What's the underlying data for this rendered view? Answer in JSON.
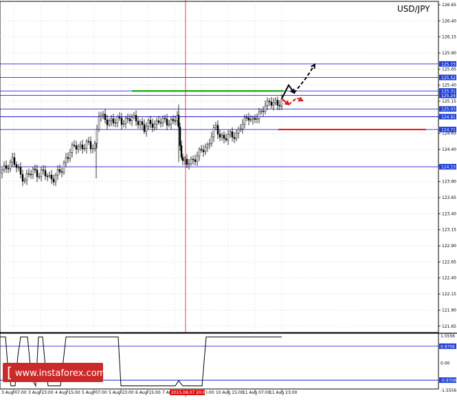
{
  "chart_data": [
    {
      "type": "candlestick",
      "title": "USD/JPY",
      "ylim": [
        121.55,
        126.75
      ],
      "ytick_labels": [
        "126.65",
        "126.40",
        "126.15",
        "125.90",
        "125.65",
        "125.40",
        "125.15",
        "124.90",
        "124.65",
        "124.40",
        "124.15",
        "123.90",
        "123.65",
        "123.40",
        "123.15",
        "122.90",
        "122.65",
        "122.40",
        "122.15",
        "121.90",
        "121.65"
      ],
      "xtick_labels": [
        "3 Aug 07:00",
        "3 Aug 23:00",
        "4 Aug 15:00",
        "5 Aug 07:00",
        "5 Aug 23:00",
        "6 Aug 15:00",
        "7 Aug 07:00",
        "7 Aug 23:00",
        "10 Aug 15:00",
        "11 Aug 07:00",
        "11 Aug 23:00"
      ],
      "crosshair_time_label": "2015.08.07 20:00",
      "levels": [
        {
          "value": 125.73,
          "label": "125.73",
          "color": "#0000cc"
        },
        {
          "value": 125.52,
          "label": "125.52",
          "color": "#0000cc"
        },
        {
          "value": 125.31,
          "label": "125.31",
          "color": "#0000cc"
        },
        {
          "value": 125.24,
          "label": "125.24",
          "color": "#0000cc"
        },
        {
          "value": 125.03,
          "label": "125.03",
          "color": "#0000cc"
        },
        {
          "value": 124.91,
          "label": "124.91",
          "color": "#0000cc"
        },
        {
          "value": 124.71,
          "label": "124.71",
          "color": "#0000cc"
        },
        {
          "value": 124.13,
          "label": "124.13",
          "color": "#0000cc"
        }
      ],
      "level_label_bg": "#1f3fd6",
      "resistance_segment": {
        "value": 125.31,
        "color": "#22aa22"
      },
      "support_segment": {
        "value": 124.71,
        "color": "#dd1111"
      },
      "crosshair_color": "#dd1111",
      "price_path": [
        {
          "x": 0,
          "y": 124.03
        },
        {
          "x": 6,
          "y": 124.08
        },
        {
          "x": 12,
          "y": 124.17
        },
        {
          "x": 18,
          "y": 124.24
        },
        {
          "x": 24,
          "y": 124.12
        },
        {
          "x": 30,
          "y": 124.0
        },
        {
          "x": 36,
          "y": 123.96
        },
        {
          "x": 42,
          "y": 124.0
        },
        {
          "x": 48,
          "y": 124.06
        },
        {
          "x": 54,
          "y": 124.03
        },
        {
          "x": 60,
          "y": 124.05
        },
        {
          "x": 66,
          "y": 124.0
        },
        {
          "x": 72,
          "y": 123.96
        },
        {
          "x": 78,
          "y": 123.97
        },
        {
          "x": 84,
          "y": 124.02
        },
        {
          "x": 90,
          "y": 124.07
        },
        {
          "x": 96,
          "y": 124.27
        },
        {
          "x": 102,
          "y": 124.38
        },
        {
          "x": 108,
          "y": 124.42
        },
        {
          "x": 114,
          "y": 124.45
        },
        {
          "x": 120,
          "y": 124.45
        },
        {
          "x": 126,
          "y": 124.48
        },
        {
          "x": 132,
          "y": 124.43
        },
        {
          "x": 138,
          "y": 124.48
        },
        {
          "x": 144,
          "y": 124.96
        },
        {
          "x": 150,
          "y": 124.87
        },
        {
          "x": 156,
          "y": 124.84
        },
        {
          "x": 162,
          "y": 124.86
        },
        {
          "x": 168,
          "y": 124.83
        },
        {
          "x": 174,
          "y": 124.85
        },
        {
          "x": 180,
          "y": 124.84
        },
        {
          "x": 186,
          "y": 124.88
        },
        {
          "x": 192,
          "y": 124.86
        },
        {
          "x": 198,
          "y": 124.88
        },
        {
          "x": 204,
          "y": 124.82
        },
        {
          "x": 210,
          "y": 124.7
        },
        {
          "x": 216,
          "y": 124.79
        },
        {
          "x": 222,
          "y": 124.82
        },
        {
          "x": 228,
          "y": 124.8
        },
        {
          "x": 234,
          "y": 124.83
        },
        {
          "x": 240,
          "y": 124.85
        },
        {
          "x": 246,
          "y": 124.84
        },
        {
          "x": 252,
          "y": 124.81
        },
        {
          "x": 258,
          "y": 124.92
        },
        {
          "x": 262,
          "y": 124.5
        },
        {
          "x": 266,
          "y": 124.2
        },
        {
          "x": 272,
          "y": 124.17
        },
        {
          "x": 278,
          "y": 124.22
        },
        {
          "x": 284,
          "y": 124.28
        },
        {
          "x": 290,
          "y": 124.33
        },
        {
          "x": 296,
          "y": 124.4
        },
        {
          "x": 302,
          "y": 124.46
        },
        {
          "x": 308,
          "y": 124.63
        },
        {
          "x": 314,
          "y": 124.72
        },
        {
          "x": 320,
          "y": 124.62
        },
        {
          "x": 326,
          "y": 124.59
        },
        {
          "x": 332,
          "y": 124.6
        },
        {
          "x": 338,
          "y": 124.6
        },
        {
          "x": 344,
          "y": 124.65
        },
        {
          "x": 350,
          "y": 124.76
        },
        {
          "x": 356,
          "y": 124.82
        },
        {
          "x": 362,
          "y": 124.92
        },
        {
          "x": 368,
          "y": 124.86
        },
        {
          "x": 374,
          "y": 124.9
        },
        {
          "x": 380,
          "y": 124.95
        },
        {
          "x": 386,
          "y": 125.14
        },
        {
          "x": 392,
          "y": 125.12
        },
        {
          "x": 398,
          "y": 125.1
        },
        {
          "x": 404,
          "y": 125.11
        },
        {
          "x": 410,
          "y": 125.19
        }
      ],
      "forecast_paths": [
        {
          "color": "#000000",
          "style": "solid",
          "points": [
            [
              410,
              125.19
            ],
            [
              420,
              125.4
            ],
            [
              428,
              125.28
            ]
          ]
        },
        {
          "color": "#000000",
          "style": "dashed",
          "points": [
            [
              428,
              125.28
            ],
            [
              446,
              125.52
            ],
            [
              458,
              125.72
            ]
          ]
        },
        {
          "color": "#dd1111",
          "style": "solid",
          "points": [
            [
              410,
              125.19
            ],
            [
              420,
              125.1
            ]
          ]
        },
        {
          "color": "#dd1111",
          "style": "dashed",
          "points": [
            [
              420,
              125.1
            ],
            [
              432,
              125.2
            ],
            [
              440,
              125.16
            ]
          ]
        }
      ]
    },
    {
      "type": "line",
      "name": "oscillator",
      "ylim": [
        -1.5556,
        1.5556
      ],
      "ytick_labels": [
        "1.5556",
        "0.9706",
        "0.00",
        "-0.9706",
        "-1.5556"
      ],
      "levels": [
        {
          "value": 0.9706,
          "label": "0.9706"
        },
        {
          "value": -0.9706,
          "label": "-0.9706"
        }
      ],
      "series": [
        {
          "values": [
            [
              0,
              1.5
            ],
            [
              8,
              1.5
            ],
            [
              12,
              -0.5
            ],
            [
              16,
              -1.3
            ],
            [
              22,
              -1.3
            ],
            [
              26,
              0.4
            ],
            [
              30,
              1.5
            ],
            [
              40,
              1.5
            ],
            [
              46,
              -0.9
            ],
            [
              52,
              -1.3
            ],
            [
              56,
              1.5
            ],
            [
              62,
              1.5
            ],
            [
              66,
              -0.2
            ],
            [
              70,
              -1.3
            ],
            [
              88,
              -1.3
            ],
            [
              96,
              1.5
            ],
            [
              172,
              1.5
            ],
            [
              176,
              -1.3
            ],
            [
              255,
              -1.3
            ],
            [
              260,
              -1.0
            ],
            [
              266,
              -1.3
            ],
            [
              294,
              -1.3
            ],
            [
              300,
              1.5
            ],
            [
              410,
              1.5
            ]
          ]
        }
      ]
    }
  ],
  "watermark": {
    "text": "www.instaforex.com",
    "bracket": "["
  }
}
